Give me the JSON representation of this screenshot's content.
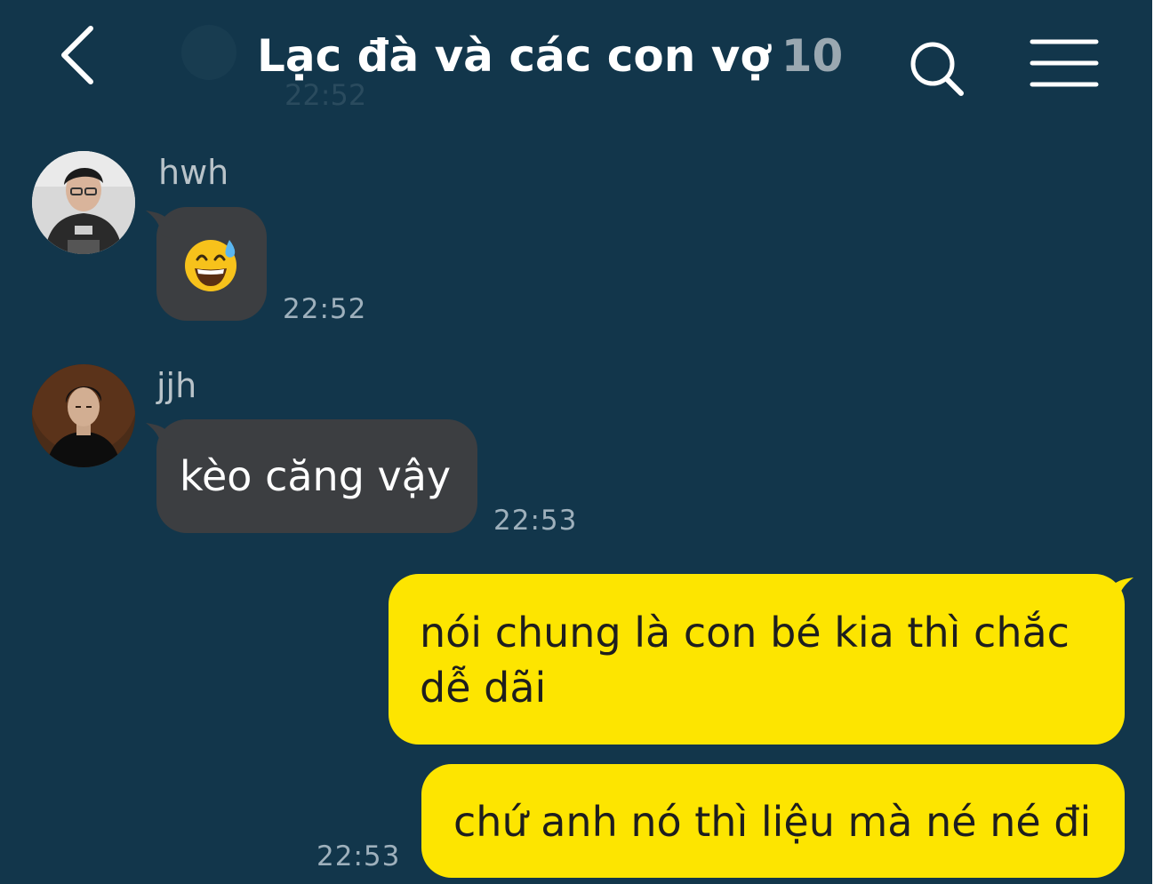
{
  "header": {
    "title": "Lạc đà và các con vợ",
    "member_count": "10",
    "ghost_time": "22:52",
    "back_icon": "chevron-left-icon",
    "search_icon": "search-icon",
    "menu_icon": "hamburger-menu-icon"
  },
  "messages": [
    {
      "sender": "hwh",
      "text": "😅",
      "time": "22:52",
      "direction": "incoming"
    },
    {
      "sender": "jjh",
      "text": "kèo căng vậy",
      "time": "22:53",
      "direction": "incoming"
    },
    {
      "sender": "",
      "text_line1": "nói chung là con bé kia thì chắc",
      "text_line2": "dễ dãi",
      "direction": "outgoing"
    },
    {
      "sender": "",
      "text": "chứ anh nó thì liệu mà né né đi",
      "time": "22:53",
      "direction": "outgoing"
    }
  ],
  "colors": {
    "background": "#12364b",
    "incoming_bubble": "#3c3e41",
    "outgoing_bubble": "#fde500",
    "timestamp": "#9eb0bc"
  }
}
